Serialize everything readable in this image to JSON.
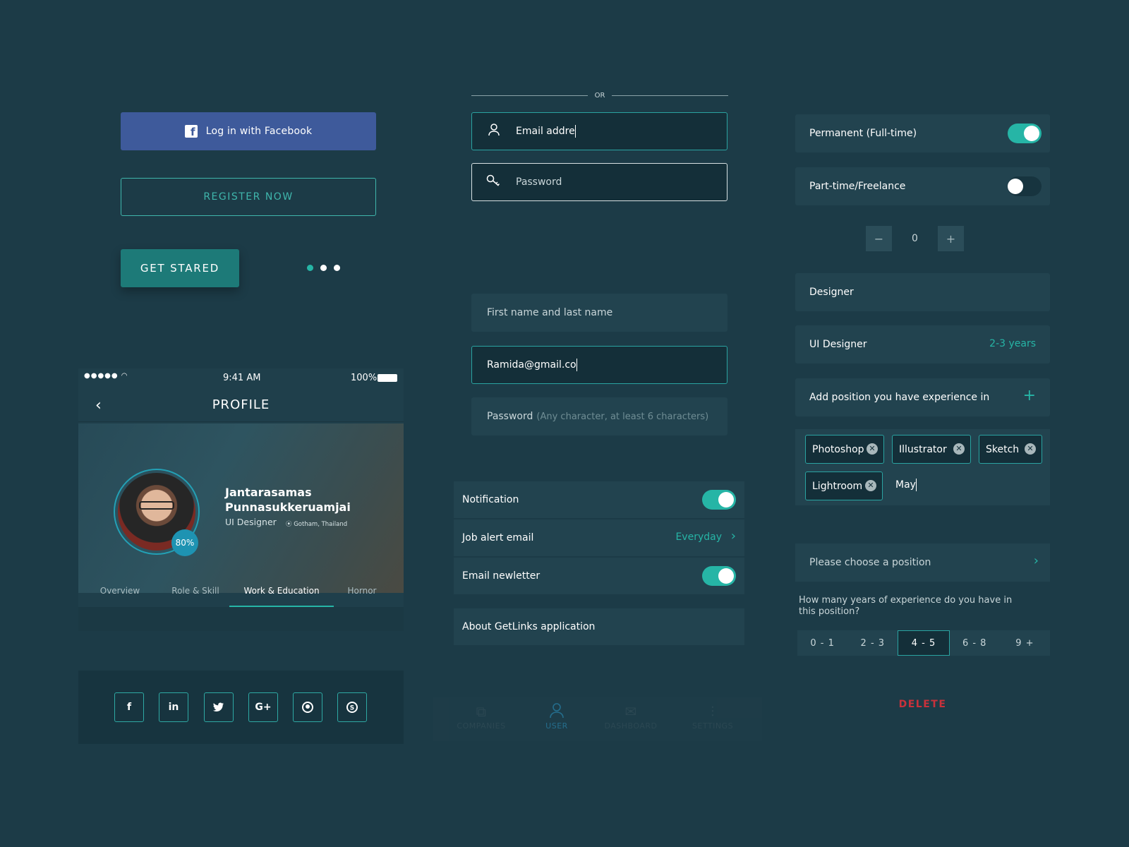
{
  "auth": {
    "facebook_label": "Log in with Facebook",
    "register_label": "REGISTER NOW",
    "get_started_label": "GET STARED",
    "pager": {
      "count": 3,
      "active": 0
    }
  },
  "login": {
    "or_label": "OR",
    "email_value": "Email addre",
    "password_placeholder": "Password"
  },
  "signup": {
    "name_placeholder": "First name and last name",
    "email_value": "Ramida@gmail.co",
    "password_label": "Password",
    "password_hint": "(Any character, at least 6 characters)"
  },
  "profile": {
    "status_time": "9:41 AM",
    "battery": "100%",
    "title": "PROFILE",
    "name": "Jantarasamas Punnasukkeruamjai",
    "role": "UI Designer",
    "location": "Gotham, Thailand",
    "completion": "80%",
    "tabs": [
      "Overview",
      "Role & Skill",
      "Work & Education",
      "Hornor"
    ],
    "active_tab": 2
  },
  "social_icons": [
    "facebook-icon",
    "linkedin-icon",
    "twitter-icon",
    "google-plus-icon",
    "github-icon",
    "skype-icon"
  ],
  "settings": {
    "notification": {
      "label": "Notification",
      "on": true
    },
    "job_alert": {
      "label": "Job alert email",
      "value": "Everyday"
    },
    "newsletter": {
      "label": "Email newletter",
      "on": true
    },
    "about": "About GetLinks application"
  },
  "tabbar": {
    "items": [
      "COMPANIES",
      "USER",
      "DASHBOARD",
      "SETTINGS"
    ],
    "active": 1
  },
  "job": {
    "permanent": {
      "label": "Permanent (Full-time)",
      "on": true
    },
    "part_time": {
      "label": "Part-time/Freelance",
      "on": false
    },
    "stepper_value": "0",
    "position": "Designer",
    "experience_title": "UI Designer",
    "experience_years": "2-3 years",
    "add_position": "Add position you have experience in",
    "tags": [
      "Photoshop",
      "Illustrator",
      "Sketch",
      "Lightroom"
    ],
    "tag_input": "May",
    "choose_position": "Please choose a position",
    "question": "How many years of experience do you have in this position?",
    "ranges": [
      "0 - 1",
      "2 - 3",
      "4 - 5",
      "6 - 8",
      "9 +"
    ],
    "selected_range": 2,
    "delete_label": "DELETE"
  },
  "colors": {
    "background": "#1c3b47",
    "accent": "#26b5a6",
    "facebook": "#3e5a9b",
    "danger": "#c8313b"
  }
}
